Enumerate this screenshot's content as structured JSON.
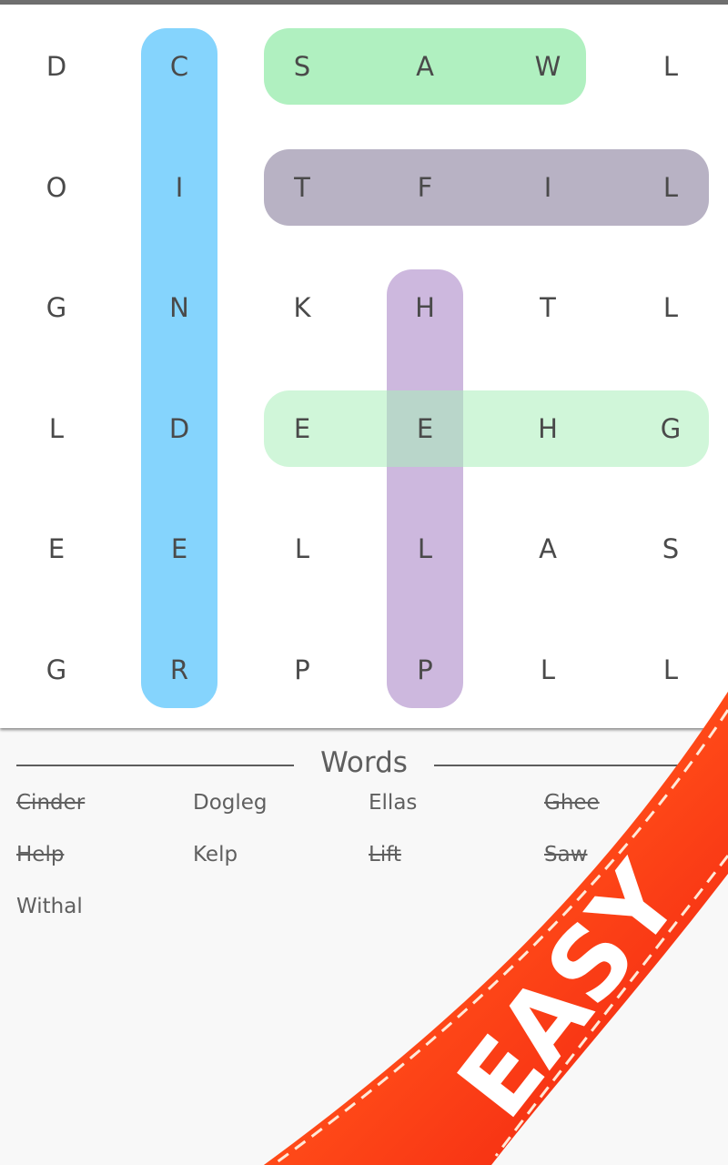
{
  "grid": {
    "rows": [
      [
        "D",
        "C",
        "S",
        "A",
        "W",
        "L"
      ],
      [
        "O",
        "I",
        "T",
        "F",
        "I",
        "L"
      ],
      [
        "G",
        "N",
        "K",
        "H",
        "T",
        "L"
      ],
      [
        "L",
        "D",
        "E",
        "E",
        "H",
        "G"
      ],
      [
        "E",
        "E",
        "L",
        "L",
        "A",
        "S"
      ],
      [
        "G",
        "R",
        "P",
        "P",
        "L",
        "L"
      ]
    ],
    "highlights": [
      {
        "word": "Cinder",
        "from": [
          0,
          1
        ],
        "to": [
          5,
          1
        ],
        "color": "#85d4fd"
      },
      {
        "word": "Saw",
        "from": [
          0,
          2
        ],
        "to": [
          0,
          4
        ],
        "color": "#b0f0c0"
      },
      {
        "word": "Lift",
        "from": [
          1,
          5
        ],
        "to": [
          1,
          2
        ],
        "color": "#b8b2c4"
      },
      {
        "word": "Help",
        "from": [
          2,
          3
        ],
        "to": [
          5,
          3
        ],
        "color": "#cdb8de"
      },
      {
        "word": "Ghee",
        "from": [
          3,
          5
        ],
        "to": [
          3,
          2
        ],
        "color": "rgba(170,238,185,0.55)"
      }
    ]
  },
  "words_section": {
    "title": "Words",
    "words": [
      {
        "label": "Cinder",
        "found": true
      },
      {
        "label": "Dogleg",
        "found": false
      },
      {
        "label": "Ellas",
        "found": false
      },
      {
        "label": "Ghee",
        "found": true
      },
      {
        "label": "Help",
        "found": true
      },
      {
        "label": "Kelp",
        "found": false
      },
      {
        "label": "Lift",
        "found": true
      },
      {
        "label": "Saw",
        "found": true
      },
      {
        "label": "Withal",
        "found": false
      }
    ]
  },
  "ribbon": {
    "label": "EASY",
    "color": "#ff3d14"
  },
  "colors": {
    "letter": "#4a4a4a",
    "word_text": "#5f5f5f",
    "board_bg": "#ffffff",
    "words_bg": "#f8f8f8"
  }
}
